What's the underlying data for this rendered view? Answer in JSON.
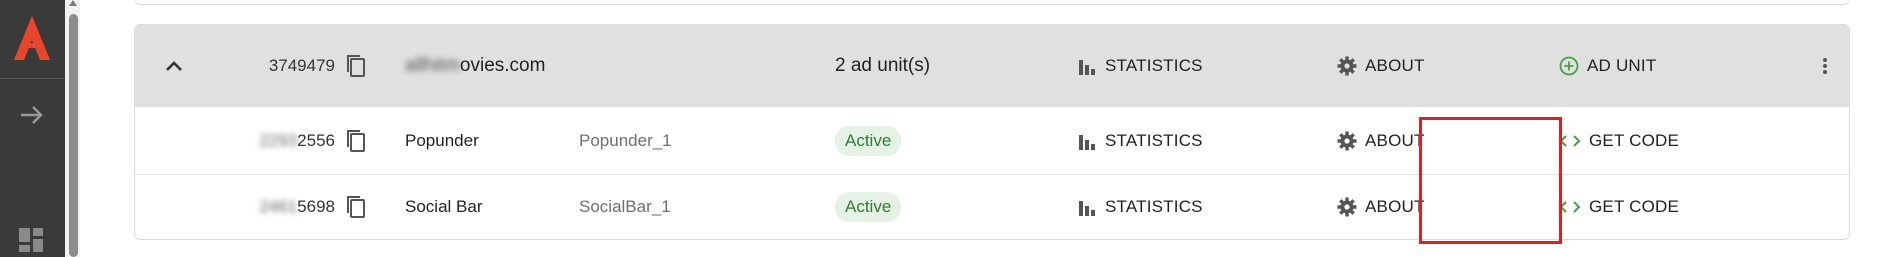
{
  "colors": {
    "rail": "#3a3a3a",
    "logo": "#e8452c",
    "header_row": "#e0e0e0",
    "active_badge_bg": "#e6f2e6",
    "active_badge_text": "#2e7d32",
    "add_icon": "#43a047",
    "code_icon": "#43a047",
    "highlight": "#e02020"
  },
  "sidebar": {
    "icons": [
      "adsterra-logo-icon",
      "arrow-right-icon",
      "dashboard-icon"
    ]
  },
  "site": {
    "id": "3749479",
    "domain_blurred": "allhitm",
    "domain_visible": "ovies.com",
    "units": "2 ad unit(s)",
    "statistics_label": "STATISTICS",
    "about_label": "ABOUT",
    "add_unit_label": "AD UNIT"
  },
  "ad_units": [
    {
      "id_blurred": "2293",
      "id_visible": "2556",
      "type": "Popunder",
      "name": "Popunder_1",
      "status": "Active",
      "statistics_label": "STATISTICS",
      "about_label": "ABOUT",
      "get_code_label": "GET CODE"
    },
    {
      "id_blurred": "2461",
      "id_visible": "5698",
      "type": "Social Bar",
      "name": "SocialBar_1",
      "status": "Active",
      "statistics_label": "STATISTICS",
      "about_label": "ABOUT",
      "get_code_label": "GET CODE"
    }
  ]
}
